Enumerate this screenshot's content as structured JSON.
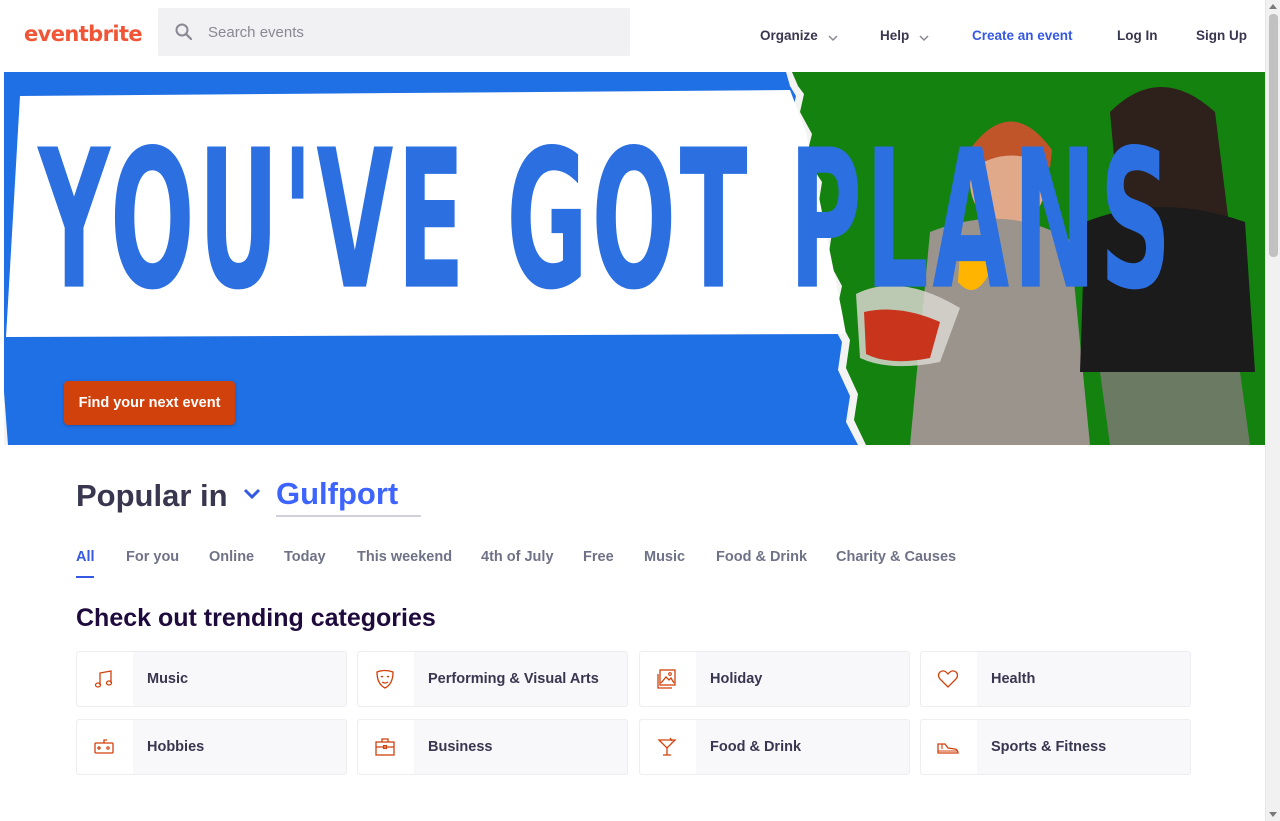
{
  "header": {
    "logo": "eventbrite",
    "search_placeholder": "Search events",
    "nav": {
      "organize": "Organize",
      "help": "Help",
      "create": "Create an event",
      "login": "Log In",
      "signup": "Sign Up"
    }
  },
  "hero": {
    "headline": "YOU'VE GOT PLANS",
    "cta": "Find your next event"
  },
  "popular": {
    "prefix": "Popular in",
    "location": "Gulfport"
  },
  "tabs": [
    {
      "label": "All",
      "active": true
    },
    {
      "label": "For you"
    },
    {
      "label": "Online"
    },
    {
      "label": "Today"
    },
    {
      "label": "This weekend"
    },
    {
      "label": "4th of July"
    },
    {
      "label": "Free"
    },
    {
      "label": "Music"
    },
    {
      "label": "Food & Drink"
    },
    {
      "label": "Charity & Causes"
    }
  ],
  "trending": {
    "title": "Check out trending categories",
    "categories": [
      {
        "label": "Music",
        "icon": "music-note-icon"
      },
      {
        "label": "Performing & Visual Arts",
        "icon": "theater-mask-icon"
      },
      {
        "label": "Holiday",
        "icon": "photo-frame-icon"
      },
      {
        "label": "Health",
        "icon": "heart-icon"
      },
      {
        "label": "Hobbies",
        "icon": "game-controller-icon"
      },
      {
        "label": "Business",
        "icon": "briefcase-icon"
      },
      {
        "label": "Food & Drink",
        "icon": "cocktail-icon"
      },
      {
        "label": "Sports & Fitness",
        "icon": "sneaker-icon"
      }
    ]
  },
  "colors": {
    "brand": "#f05537",
    "cta": "#d1410c",
    "link": "#3659e3",
    "hero_blue": "#2b6fe0",
    "hero_green": "#13820f"
  }
}
